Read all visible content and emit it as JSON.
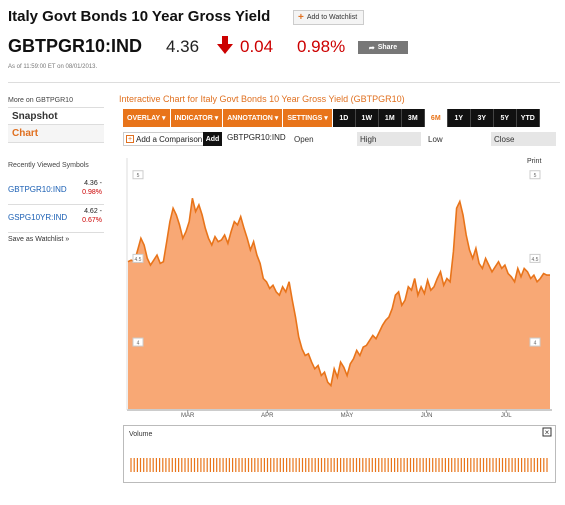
{
  "header": {
    "title": "Italy Govt Bonds 10 Year Gross Yield",
    "watchlist_label": "Add to Watchlist",
    "ticker": "GBTPGR10:IND",
    "price": "4.36",
    "change": "0.04",
    "change_pct": "0.98%",
    "share_label": "Share",
    "as_of": "As of 11:59:00 ET on 08/01/2013."
  },
  "sidebar": {
    "more_on": "More on GBTPGR10",
    "links": [
      {
        "label": "Snapshot"
      },
      {
        "label": "Chart"
      }
    ],
    "recent_title": "Recently Viewed Symbols",
    "recent": [
      {
        "symbol": "GBTPGR10:IND",
        "price": "4.36 -",
        "pct": "0.98%"
      },
      {
        "symbol": "GSPG10YR:IND",
        "price": "4.62 -",
        "pct": "0.67%"
      }
    ],
    "save_watchlist": "Save as Watchlist",
    "save_arrow": "»"
  },
  "chart_panel": {
    "title": "Interactive Chart for Italy Govt Bonds 10 Year Gross Yield (GBTPGR10)",
    "menus": [
      "OVERLAY ▾",
      "INDICATOR ▾",
      "ANNOTATION ▾",
      "SETTINGS ▾"
    ],
    "ranges": [
      "1D",
      "1W",
      "1M",
      "3M",
      "6M",
      "1Y",
      "3Y",
      "5Y",
      "YTD"
    ],
    "active_range": "6M",
    "add_comparison": "Add a Comparison",
    "add_button": "Add",
    "symbol": "GBTPGR10:IND",
    "open_label": "Open",
    "high_label": "High",
    "low_label": "Low",
    "close_label": "Close",
    "print_label": "Print",
    "volume_label": "Volume",
    "close_icon": "×"
  },
  "colors": {
    "accent": "#e8741a",
    "area_fill": "#f8a875",
    "line": "#e8741a",
    "down": "#cc0000",
    "link": "#1a5fb4"
  },
  "chart_data": {
    "type": "area",
    "x_ticks": [
      "MAR",
      "APR",
      "MAY",
      "JUN",
      "JUL"
    ],
    "y_ticks": [
      "4",
      "4.5",
      "5"
    ],
    "ylim": [
      3.6,
      5.1
    ],
    "values": [
      4.48,
      4.49,
      4.48,
      4.55,
      4.62,
      4.58,
      4.5,
      4.46,
      4.49,
      4.52,
      4.47,
      4.48,
      4.6,
      4.72,
      4.8,
      4.76,
      4.7,
      4.62,
      4.66,
      4.72,
      4.86,
      4.78,
      4.82,
      4.76,
      4.68,
      4.62,
      4.58,
      4.63,
      4.6,
      4.61,
      4.64,
      4.59,
      4.66,
      4.72,
      4.7,
      4.75,
      4.68,
      4.62,
      4.55,
      4.6,
      4.52,
      4.47,
      4.38,
      4.36,
      4.32,
      4.34,
      4.3,
      4.28,
      4.33,
      4.3,
      4.36,
      4.25,
      4.15,
      4.03,
      3.96,
      3.92,
      3.93,
      3.88,
      3.84,
      3.86,
      3.8,
      3.82,
      3.76,
      3.74,
      3.84,
      3.79,
      3.88,
      3.85,
      3.8,
      3.87,
      3.9,
      3.95,
      3.92,
      3.97,
      3.98,
      4.01,
      4.04,
      4.02,
      4.06,
      4.1,
      4.13,
      4.15,
      4.2,
      4.28,
      4.3,
      4.22,
      4.25,
      4.33,
      4.31,
      4.38,
      4.28,
      4.33,
      4.29,
      4.37,
      4.31,
      4.33,
      4.38,
      4.42,
      4.34,
      4.38,
      4.36,
      4.54,
      4.8,
      4.84,
      4.76,
      4.64,
      4.55,
      4.5,
      4.56,
      4.47,
      4.44,
      4.5,
      4.46,
      4.42,
      4.45,
      4.48,
      4.44,
      4.46,
      4.41,
      4.39,
      4.36,
      4.44,
      4.39,
      4.44,
      4.42,
      4.38,
      4.4,
      4.36,
      4.38,
      4.41,
      4.4,
      4.4
    ],
    "grid": false
  }
}
